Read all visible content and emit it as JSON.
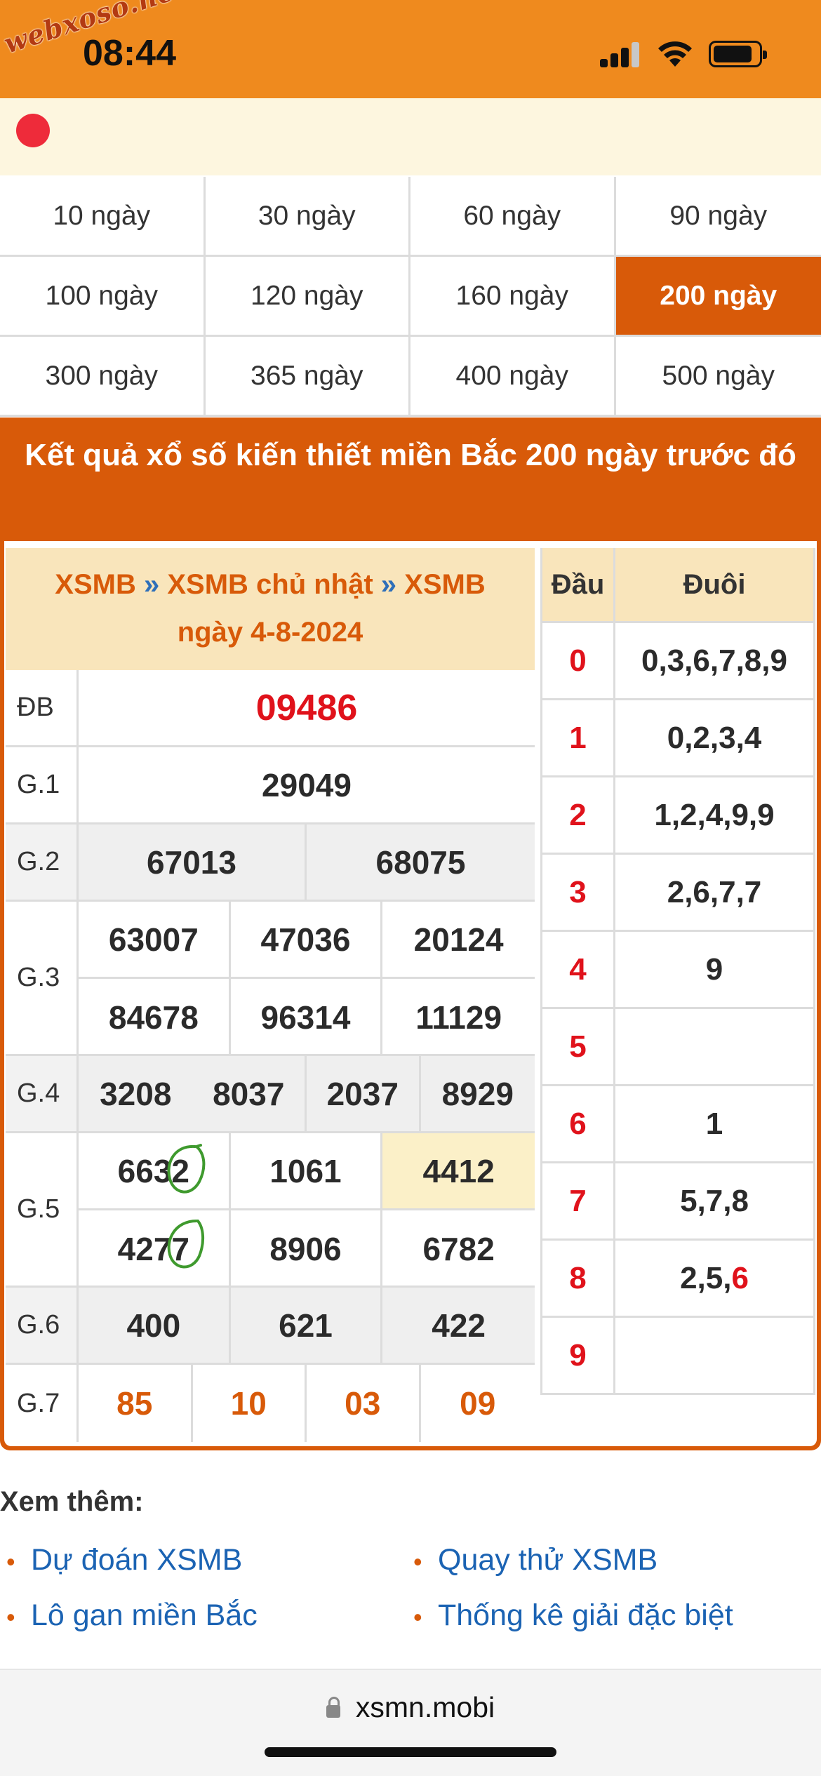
{
  "watermark": "webxoso.net",
  "status_bar": {
    "time": "08:44"
  },
  "day_options": [
    "10 ngày",
    "30 ngày",
    "60 ngày",
    "90 ngày",
    "100 ngày",
    "120 ngày",
    "160 ngày",
    "200 ngày",
    "300 ngày",
    "365 ngày",
    "400 ngày",
    "500 ngày"
  ],
  "selected_day_option": "200 ngày",
  "banner_title": "Kết quả xổ số kiến thiết miền Bắc 200 ngày trước đó",
  "result_header": {
    "crumb1": "XSMB",
    "sep1": " » ",
    "crumb2": "XSMB chủ nhật",
    "sep2": " » ",
    "crumb3": "XSMB",
    "date_line": "ngày 4-8-2024"
  },
  "prizes": {
    "db": {
      "label": "ĐB",
      "values": [
        "09486"
      ]
    },
    "g1": {
      "label": "G.1",
      "values": [
        "29049"
      ]
    },
    "g2": {
      "label": "G.2",
      "values": [
        "67013",
        "68075"
      ]
    },
    "g3": {
      "label": "G.3",
      "values": [
        "63007",
        "47036",
        "20124",
        "84678",
        "96314",
        "11129"
      ]
    },
    "g4": {
      "label": "G.4",
      "values": [
        "3208",
        "8037",
        "2037",
        "8929"
      ]
    },
    "g5": {
      "label": "G.5",
      "values": [
        "6632",
        "1061",
        "4412",
        "4277",
        "8906",
        "6782"
      ]
    },
    "g6": {
      "label": "G.6",
      "values": [
        "400",
        "621",
        "422"
      ]
    },
    "g7": {
      "label": "G.7",
      "values": [
        "85",
        "10",
        "03",
        "09"
      ]
    }
  },
  "head_tail": {
    "head_label": "Đầu",
    "tail_label": "Đuôi",
    "rows": [
      {
        "d": "0",
        "t": "0,3,6,7,8,9"
      },
      {
        "d": "1",
        "t": "0,2,3,4"
      },
      {
        "d": "2",
        "t": "1,2,4,9,9"
      },
      {
        "d": "3",
        "t": "2,6,7,7"
      },
      {
        "d": "4",
        "t": "9"
      },
      {
        "d": "5",
        "t": ""
      },
      {
        "d": "6",
        "t": "1"
      },
      {
        "d": "7",
        "t": "5,7,8"
      },
      {
        "d": "8",
        "t": "2,5,",
        "t_red": "6"
      },
      {
        "d": "9",
        "t": ""
      }
    ]
  },
  "see_more": {
    "title": "Xem thêm:",
    "links": [
      "Dự đoán XSMB",
      "Quay thử XSMB",
      "Lô gan miền Bắc",
      "Thống kê giải đặc biệt"
    ]
  },
  "browser": {
    "url": "xsmn.mobi"
  },
  "colors": {
    "header_orange": "#ef8a1e",
    "accent": "#d85a09",
    "red": "#e0121b",
    "link": "#1b63b3"
  }
}
